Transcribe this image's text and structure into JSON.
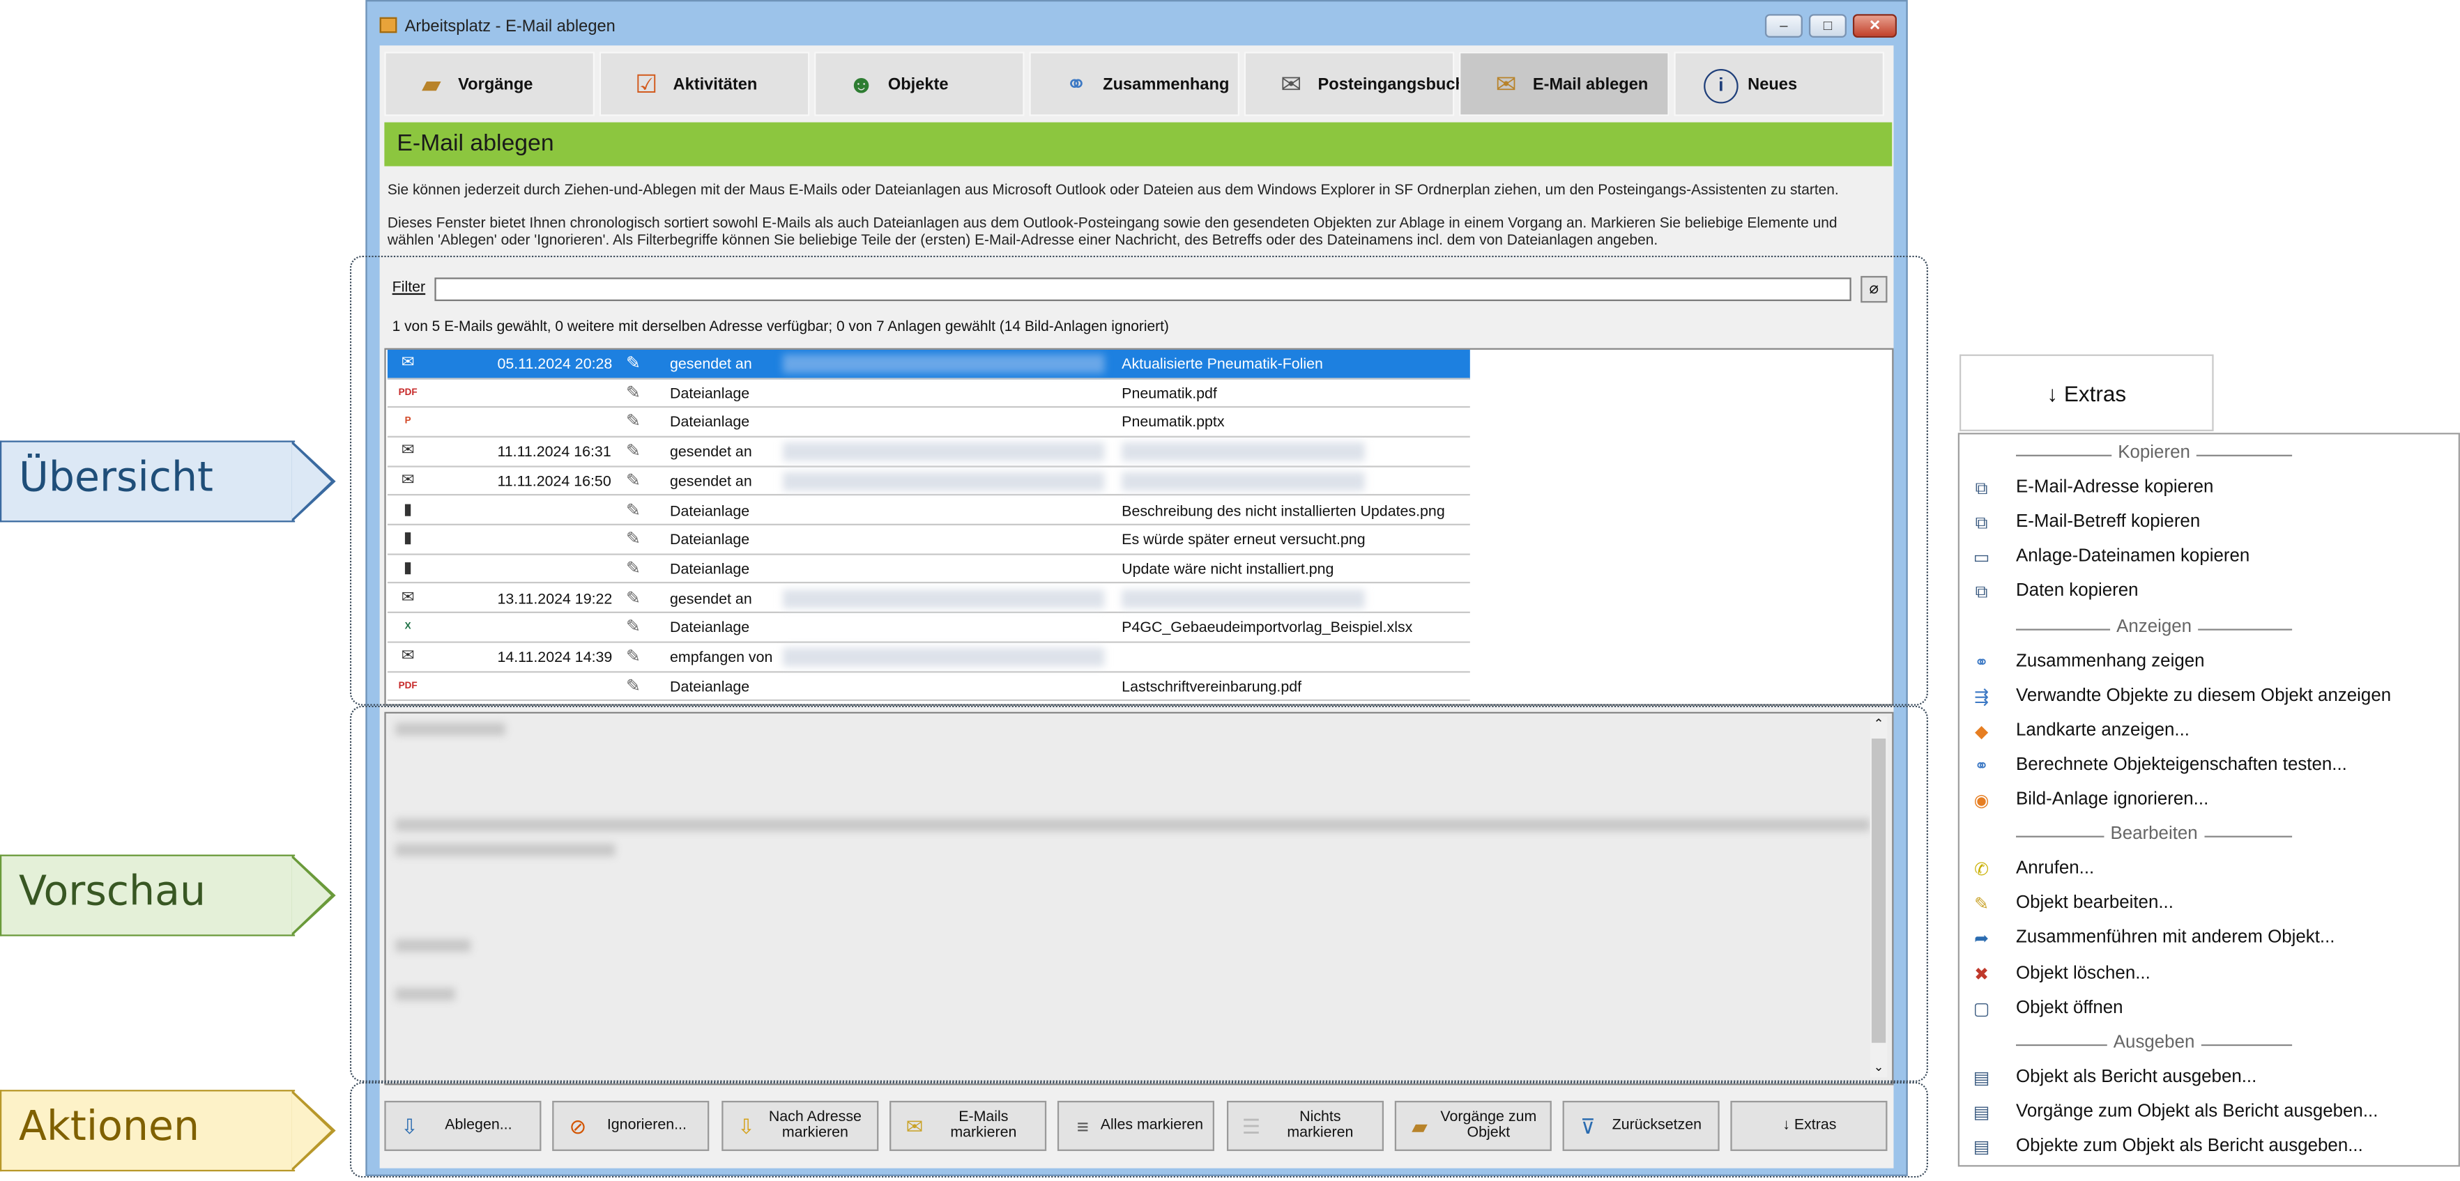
{
  "window": {
    "title": "Arbeitsplatz - E-Mail ablegen",
    "tabs": [
      {
        "label": "Vorgänge",
        "icon": "folder-icon"
      },
      {
        "label": "Aktivitäten",
        "icon": "checklist-icon"
      },
      {
        "label": "Objekte",
        "icon": "people-icon"
      },
      {
        "label": "Zusammenhang",
        "icon": "network-icon"
      },
      {
        "label": "Posteingangsbuch",
        "icon": "mail-icon"
      },
      {
        "label": "E-Mail ablegen",
        "icon": "mail-folder-icon"
      },
      {
        "label": "Neues",
        "icon": "info-icon"
      }
    ],
    "section_title": "E-Mail ablegen",
    "info1": "Sie können jederzeit durch Ziehen-und-Ablegen mit der Maus E-Mails oder Dateianlagen aus Microsoft Outlook oder Dateien aus dem Windows Explorer in SF Ordnerplan ziehen, um den Posteingangs-Assistenten zu starten.",
    "info2": "Dieses Fenster bietet Ihnen chronologisch sortiert sowohl E-Mails als auch Dateianlagen aus dem Outlook-Posteingang sowie den gesendeten Objekten zur Ablage in einem Vorgang an. Markieren Sie beliebige Elemente und wählen 'Ablegen' oder 'Ignorieren'. Als Filterbegriffe können Sie beliebige Teile der (ersten) E-Mail-Adresse einer Nachricht, des Betreffs oder des Dateinamens incl. dem von Dateianlagen angeben.",
    "filter_label": "Filter",
    "filter_value": "",
    "status": "1 von 5 E-Mails gewählt, 0 weitere mit derselben Adresse verfügbar; 0 von 7 Anlagen gewählt (14 Bild-Anlagen ignoriert)",
    "rows": [
      {
        "icon": "mail-icon",
        "date": "05.11.2024 20:28",
        "kind": "gesendet an",
        "subject": "Aktualisierte Pneumatik-Folien",
        "blur_who": true,
        "blur_subject": false
      },
      {
        "icon": "pdf-icon",
        "date": "",
        "kind": "Dateianlage",
        "subject": "Pneumatik.pdf",
        "blur_who": false,
        "blur_subject": false
      },
      {
        "icon": "pptx-icon",
        "date": "",
        "kind": "Dateianlage",
        "subject": "Pneumatik.pptx",
        "blur_who": false,
        "blur_subject": false
      },
      {
        "icon": "mail-icon",
        "date": "11.11.2024 16:31",
        "kind": "gesendet an",
        "subject": "",
        "blur_who": true,
        "blur_subject": true
      },
      {
        "icon": "mail-icon",
        "date": "11.11.2024 16:50",
        "kind": "gesendet an",
        "subject": "",
        "blur_who": true,
        "blur_subject": true
      },
      {
        "icon": "image-icon",
        "date": "",
        "kind": "Dateianlage",
        "subject": "Beschreibung des nicht installierten Updates.png",
        "blur_who": false,
        "blur_subject": false
      },
      {
        "icon": "image-icon",
        "date": "",
        "kind": "Dateianlage",
        "subject": "Es würde später erneut versucht.png",
        "blur_who": false,
        "blur_subject": false
      },
      {
        "icon": "image-icon",
        "date": "",
        "kind": "Dateianlage",
        "subject": "Update wäre nicht installiert.png",
        "blur_who": false,
        "blur_subject": false
      },
      {
        "icon": "mail-icon",
        "date": "13.11.2024 19:22",
        "kind": "gesendet an",
        "subject": "",
        "blur_who": true,
        "blur_subject": true
      },
      {
        "icon": "xlsx-icon",
        "date": "",
        "kind": "Dateianlage",
        "subject": "P4GC_Gebaeudeimportvorlag_Beispiel.xlsx",
        "blur_who": false,
        "blur_subject": false
      },
      {
        "icon": "mail-icon",
        "date": "14.11.2024 14:39",
        "kind": "empfangen von",
        "subject": "",
        "blur_who": true,
        "blur_subject": false
      },
      {
        "icon": "pdf-icon",
        "date": "",
        "kind": "Dateianlage",
        "subject": "Lastschriftvereinbarung.pdf",
        "blur_who": false,
        "blur_subject": false
      }
    ],
    "actions": [
      {
        "label": "Ablegen...",
        "icon": "file-away-icon"
      },
      {
        "label": "Ignorieren...",
        "icon": "ignore-icon"
      },
      {
        "label": "Nach Adresse markieren",
        "icon": "mark-by-address-icon"
      },
      {
        "label": "E-Mails markieren",
        "icon": "mark-emails-icon"
      },
      {
        "label": "Alles markieren",
        "icon": "mark-all-icon"
      },
      {
        "label": "Nichts markieren",
        "icon": "mark-none-icon"
      },
      {
        "label": "Vorgänge zum Objekt",
        "icon": "folder-icon"
      },
      {
        "label": "Zurücksetzen",
        "icon": "reset-filter-icon"
      },
      {
        "label": "↓ Extras",
        "icon": ""
      }
    ]
  },
  "callouts": [
    {
      "label": "Übersicht",
      "fill": "#dce8f5",
      "border": "#3a6aa0",
      "color": "#1f4e79"
    },
    {
      "label": "Vorschau",
      "fill": "#e4f0d8",
      "border": "#6a9a3a",
      "color": "#385723"
    },
    {
      "label": "Aktionen",
      "fill": "#fdf2c8",
      "border": "#b8982a",
      "color": "#7f6000"
    }
  ],
  "extras_button": "↓ Extras",
  "menu": [
    {
      "type": "section",
      "label": "Kopieren"
    },
    {
      "type": "item",
      "label": "E-Mail-Adresse kopieren",
      "icon": "copy-address-icon"
    },
    {
      "type": "item",
      "label": "E-Mail-Betreff kopieren",
      "icon": "copy-subject-icon"
    },
    {
      "type": "item",
      "label": "Anlage-Dateinamen kopieren",
      "icon": "copy-attachment-icon"
    },
    {
      "type": "item",
      "label": "Daten kopieren",
      "icon": "copy-icon"
    },
    {
      "type": "section",
      "label": "Anzeigen"
    },
    {
      "type": "item",
      "label": "Zusammenhang zeigen",
      "icon": "network-icon"
    },
    {
      "type": "item",
      "label": "Verwandte Objekte zu diesem Objekt anzeigen",
      "icon": "related-icon"
    },
    {
      "type": "item",
      "label": "Landkarte anzeigen...",
      "icon": "map-icon"
    },
    {
      "type": "item",
      "label": "Berechnete Objekteigenschaften testen...",
      "icon": "properties-icon"
    },
    {
      "type": "item",
      "label": "Bild-Anlage ignorieren...",
      "icon": "ignore-image-icon"
    },
    {
      "type": "section",
      "label": "Bearbeiten"
    },
    {
      "type": "item",
      "label": "Anrufen...",
      "icon": "phone-icon"
    },
    {
      "type": "item",
      "label": "Objekt bearbeiten...",
      "icon": "edit-icon"
    },
    {
      "type": "item",
      "label": "Zusammenführen mit anderem Objekt...",
      "icon": "merge-icon"
    },
    {
      "type": "item",
      "label": "Objekt löschen...",
      "icon": "delete-icon"
    },
    {
      "type": "item",
      "label": "Objekt öffnen",
      "icon": "open-icon"
    },
    {
      "type": "section",
      "label": "Ausgeben"
    },
    {
      "type": "item",
      "label": "Objekt als Bericht ausgeben...",
      "icon": "report-icon"
    },
    {
      "type": "item",
      "label": "Vorgänge zum Objekt als Bericht ausgeben...",
      "icon": "report-folder-icon"
    },
    {
      "type": "item",
      "label": "Objekte zum Objekt als Bericht ausgeben...",
      "icon": "report-objects-icon"
    }
  ]
}
